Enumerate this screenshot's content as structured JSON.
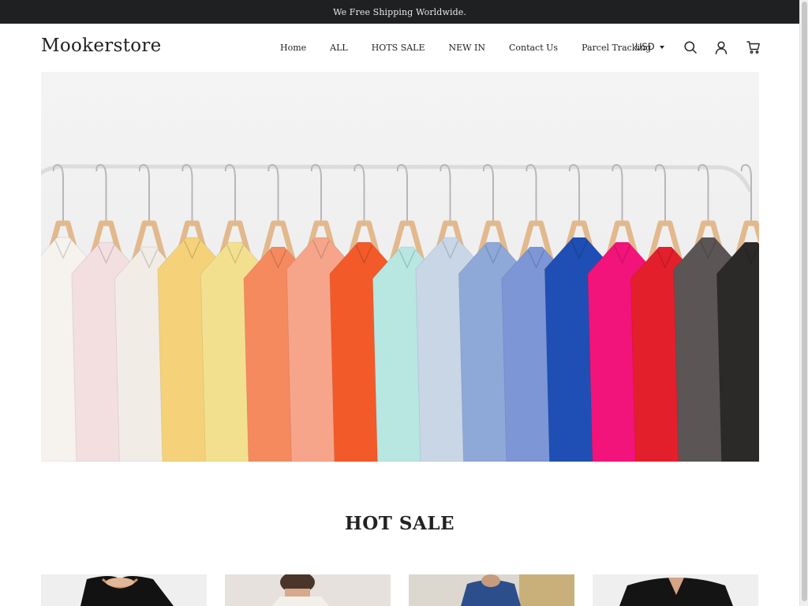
{
  "announcement": "We Free Shipping Worldwide.",
  "brand": "Mookerstore",
  "nav": [
    {
      "label": "Home"
    },
    {
      "label": "ALL"
    },
    {
      "label": "HOTS SALE"
    },
    {
      "label": "NEW IN"
    },
    {
      "label": "Contact Us"
    },
    {
      "label": "Parcel Tracking"
    }
  ],
  "currency": "USD",
  "icons": {
    "search": "search-icon",
    "account": "user-icon",
    "cart": "cart-icon",
    "currency_toggle": "chevron-down-icon"
  },
  "colors": {
    "announcement_bg": "#1f2021",
    "text": "#222222"
  },
  "hero": {
    "garment_colors": [
      "#f6f2ee",
      "#f3dfe0",
      "#f2ece6",
      "#f5d27a",
      "#f3e08f",
      "#f58a5e",
      "#f7a58a",
      "#f35a2a",
      "#b8e6e0",
      "#c8d6e6",
      "#8ea8d8",
      "#7d96d6",
      "#1f4fb4",
      "#f2147a",
      "#e41f2c",
      "#5b5655",
      "#2c2a29"
    ]
  },
  "section": {
    "title": "HOT SALE"
  },
  "products": [
    {
      "name": "product-1"
    },
    {
      "name": "product-2"
    },
    {
      "name": "product-3"
    },
    {
      "name": "product-4"
    }
  ]
}
